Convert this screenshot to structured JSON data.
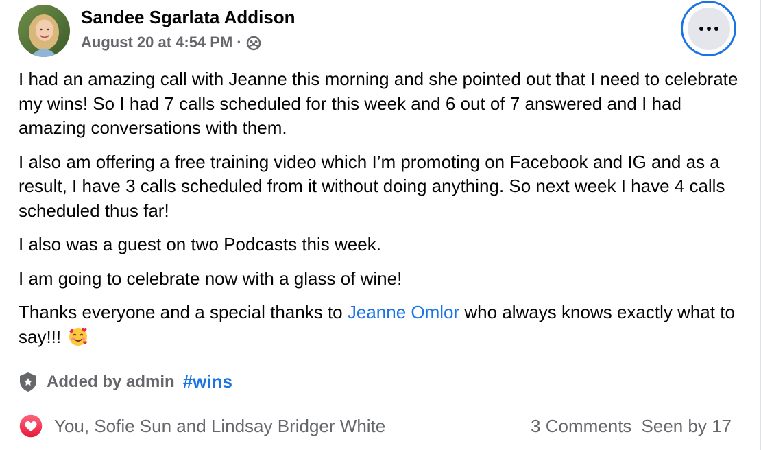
{
  "post": {
    "author": "Sandee Sgarlata Addison",
    "timestamp": "August 20 at 4:54 PM",
    "separator": "·",
    "audience_icon": "group-icon",
    "more_icon": "more-horizontal-icon"
  },
  "body": {
    "paragraphs": [
      "I had an amazing call with Jeanne this morning and she pointed out that I need to celebrate my wins! So I had 7 calls scheduled for this week and 6 out of 7 answered and I had amazing conversations with them.",
      "I also am offering a free training video which I’m promoting on Facebook and IG and as a result, I have 3 calls scheduled from it without doing anything. So next week I have 4 calls scheduled thus far!",
      "I also was a guest on two Podcasts this week.",
      "I am going to celebrate now with a glass of wine!"
    ],
    "thanks_before": "Thanks everyone and a special thanks to ",
    "mention": "Jeanne Omlor",
    "thanks_after": " who always knows exactly what to say!!!",
    "emoji": "smiling-face-with-hearts"
  },
  "tag": {
    "icon": "admin-shield-icon",
    "added_by": "Added by admin",
    "hashtag": "#wins"
  },
  "footer": {
    "reaction_icon": "love-reaction-icon",
    "reactors": "You, Sofie Sun and Lindsay Bridger White",
    "comments": "3 Comments",
    "seen_by": "Seen by 17"
  },
  "colors": {
    "link": "#1b74e4",
    "secondary_text": "#65676b",
    "love": "#f33e58"
  }
}
